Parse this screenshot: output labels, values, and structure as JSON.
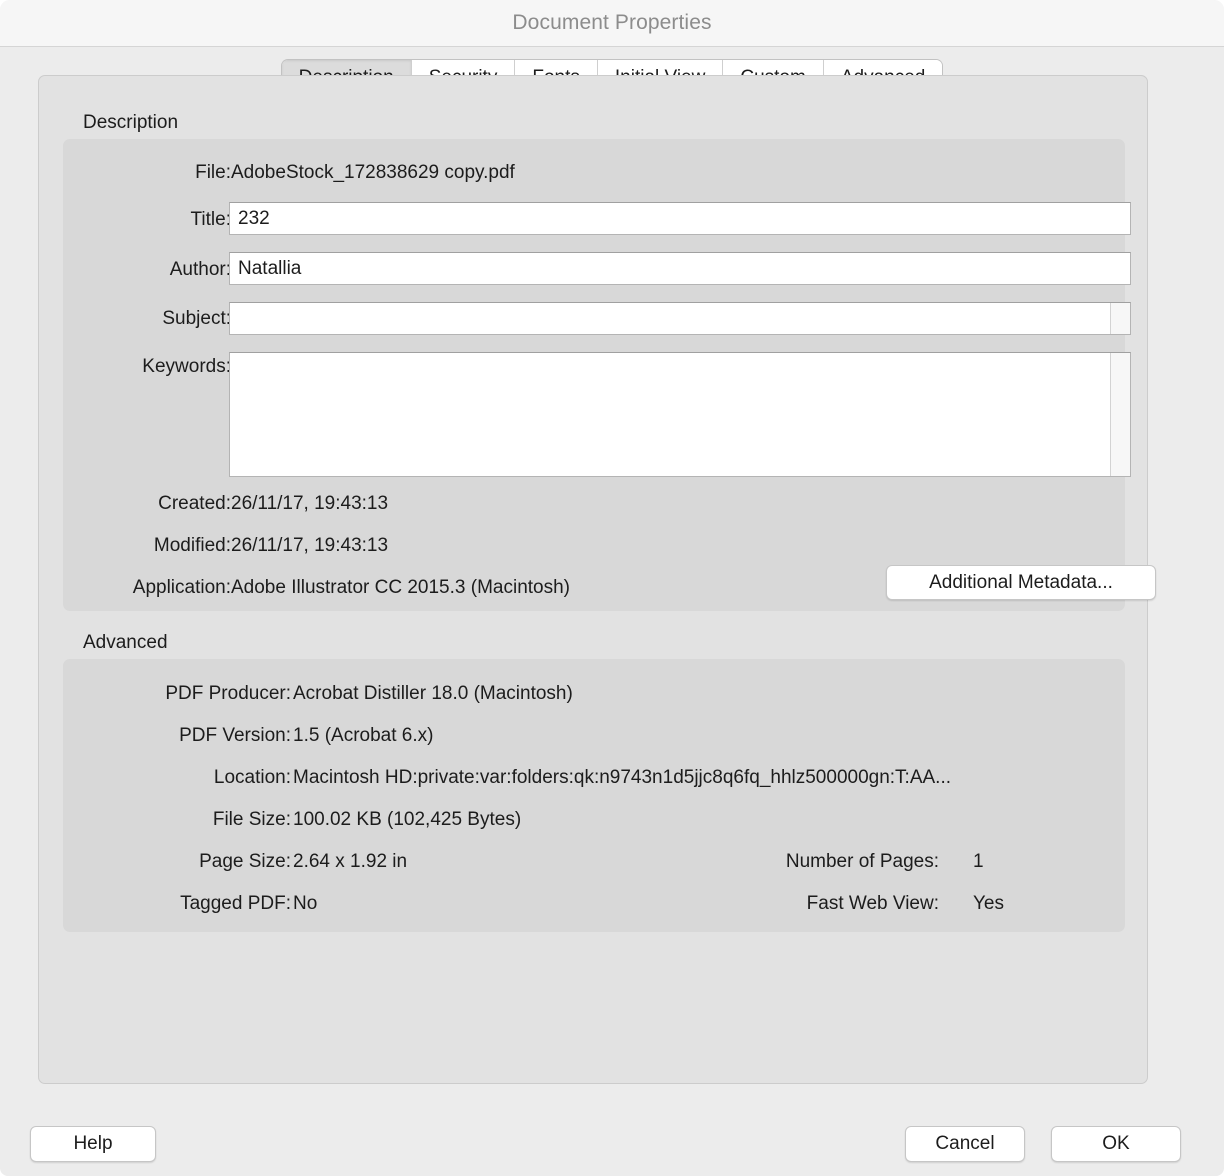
{
  "window": {
    "title": "Document Properties"
  },
  "tabs": [
    {
      "label": "Description",
      "selected": true
    },
    {
      "label": "Security",
      "selected": false
    },
    {
      "label": "Fonts",
      "selected": false
    },
    {
      "label": "Initial View",
      "selected": false
    },
    {
      "label": "Custom",
      "selected": false
    },
    {
      "label": "Advanced",
      "selected": false
    }
  ],
  "description": {
    "group_label": "Description",
    "file": {
      "label": "File:",
      "value": "AdobeStock_172838629 copy.pdf"
    },
    "title": {
      "label": "Title:",
      "value": "232",
      "placeholder": ""
    },
    "author": {
      "label": "Author:",
      "value": "Natallia",
      "placeholder": ""
    },
    "subject": {
      "label": "Subject:",
      "value": "",
      "placeholder": ""
    },
    "keywords": {
      "label": "Keywords:",
      "value": "",
      "placeholder": ""
    },
    "created": {
      "label": "Created:",
      "value": "26/11/17, 19:43:13"
    },
    "modified": {
      "label": "Modified:",
      "value": "26/11/17, 19:43:13"
    },
    "application": {
      "label": "Application:",
      "value": "Adobe Illustrator CC 2015.3 (Macintosh)"
    },
    "additional_metadata_button": "Additional Metadata..."
  },
  "advanced": {
    "group_label": "Advanced",
    "pdf_producer": {
      "label": "PDF Producer:",
      "value": "Acrobat Distiller 18.0 (Macintosh)"
    },
    "pdf_version": {
      "label": "PDF Version:",
      "value": "1.5 (Acrobat 6.x)"
    },
    "location": {
      "label": "Location:",
      "value": "Macintosh HD:private:var:folders:qk:n9743n1d5jjc8q6fq_hhlz500000gn:T:AA..."
    },
    "file_size": {
      "label": "File Size:",
      "value": "100.02 KB (102,425 Bytes)"
    },
    "page_size": {
      "label": "Page Size:",
      "value": "2.64 x 1.92 in"
    },
    "number_of_pages": {
      "label": "Number of Pages:",
      "value": "1"
    },
    "tagged_pdf": {
      "label": "Tagged PDF:",
      "value": "No"
    },
    "fast_web_view": {
      "label": "Fast Web View:",
      "value": "Yes"
    }
  },
  "footer": {
    "help": "Help",
    "cancel": "Cancel",
    "ok": "OK"
  },
  "colors": {
    "dialog_bg": "#ececec",
    "titlebar_bg": "#f6f6f6",
    "panel_bg": "#e2e2e2",
    "groupbox_bg": "#d8d8d8",
    "selected_tab_bg": "#dcdcdc",
    "field_bg": "#ffffff",
    "title_text": "#8c8c8c",
    "body_text": "#1c1c1c"
  }
}
